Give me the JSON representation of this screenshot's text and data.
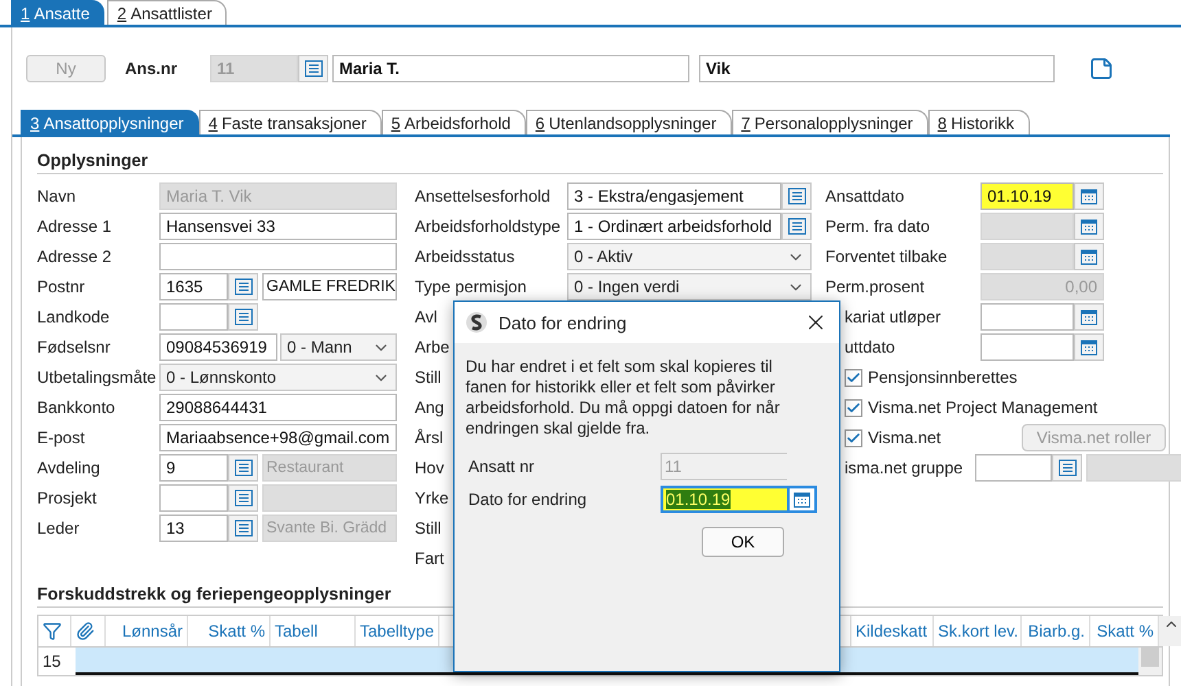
{
  "top_tabs": [
    {
      "key": "1",
      "label": "Ansatte",
      "selected": true
    },
    {
      "key": "2",
      "label": "Ansattlister",
      "selected": false
    }
  ],
  "header": {
    "new_button": {
      "label": "Ny",
      "disabled": true
    },
    "label": "Ans.nr",
    "number": "11",
    "first_name": "Maria T.",
    "last_name": "Vik"
  },
  "sub_tabs": [
    {
      "key": "3",
      "label": "Ansattopplysninger",
      "selected": true
    },
    {
      "key": "4",
      "label": "Faste transaksjoner",
      "selected": false
    },
    {
      "key": "5",
      "label": "Arbeidsforhold",
      "selected": false
    },
    {
      "key": "6",
      "label": "Utenlandsopplysninger",
      "selected": false
    },
    {
      "key": "7",
      "label": "Personalopplysninger",
      "selected": false
    },
    {
      "key": "8",
      "label": "Historikk",
      "selected": false
    }
  ],
  "section_title": "Opplysninger",
  "left_fields": [
    {
      "label": "Navn",
      "kind": "text",
      "value": "Maria T. Vik",
      "disabled": true
    },
    {
      "label": "Adresse 1",
      "kind": "text",
      "value": "Hansensvei 33",
      "disabled": false
    },
    {
      "label": "Adresse 2",
      "kind": "text",
      "disabled": false
    },
    {
      "label": "Postnr",
      "kind": "lookup",
      "value": "1635",
      "name": "GAMLE FREDRIK",
      "name_disabled": false
    },
    {
      "label": "Landkode",
      "kind": "lookup"
    },
    {
      "label": "Fødselsnr",
      "kind": "text_select",
      "value": "09084536919",
      "option": "0 - Mann"
    },
    {
      "label": "Utbetalingsmåte",
      "kind": "select",
      "value": "0 - Lønnskonto"
    },
    {
      "label": "Bankkonto",
      "kind": "text",
      "value": "29088644431",
      "disabled": false
    },
    {
      "label": "E-post",
      "kind": "text",
      "value": "Mariaabsence+98@gmail.com",
      "disabled": false
    },
    {
      "label": "Avdeling",
      "kind": "lookup",
      "value": "9",
      "name": "Restaurant",
      "name_disabled": true
    },
    {
      "label": "Prosjekt",
      "kind": "lookup",
      "name_disabled": true
    },
    {
      "label": "Leder",
      "kind": "lookup",
      "value": "13",
      "name": "Svante Bi. Grädd",
      "name_disabled": true
    }
  ],
  "middle_fields": [
    {
      "label": "Ansettelsesforhold",
      "kind": "lookup",
      "value": "3 - Ekstra/engasjement"
    },
    {
      "label": "Arbeidsforholdstype",
      "kind": "lookup",
      "value": "1 - Ordinært arbeidsforhold"
    },
    {
      "label": "Arbeidsstatus",
      "kind": "select",
      "value": "0 - Aktiv"
    },
    {
      "label": "Type permisjon",
      "kind": "select",
      "value": "0 - Ingen verdi"
    },
    {
      "label": "Avl",
      "kind": "label"
    },
    {
      "label": "Arbe",
      "kind": "label"
    },
    {
      "label": "Still",
      "kind": "label"
    },
    {
      "label": "Ang",
      "kind": "label"
    },
    {
      "label": "Årsl",
      "kind": "label"
    },
    {
      "label": "Hov",
      "kind": "label"
    },
    {
      "label": "Yrke",
      "kind": "label"
    },
    {
      "label": "Still",
      "kind": "label"
    },
    {
      "label": "Fart",
      "kind": "label"
    }
  ],
  "right_fields": [
    {
      "label": "Ansattdato",
      "kind": "date",
      "value": "01.10.19",
      "disabled": false,
      "highlighted": true
    },
    {
      "label": "Perm. fra dato",
      "kind": "date",
      "disabled": true,
      "highlighted": false
    },
    {
      "label": "Forventet tilbake",
      "kind": "date",
      "disabled": true,
      "highlighted": false
    },
    {
      "label": "Perm.prosent",
      "kind": "number",
      "value": "0,00"
    },
    {
      "label": "kariat utløper",
      "kind": "date",
      "disabled": false,
      "highlighted": false
    },
    {
      "label": "uttdato",
      "kind": "date",
      "disabled": false,
      "highlighted": false
    },
    {
      "label": "Pensjonsinnberettes",
      "kind": "checkbox",
      "checked": true
    },
    {
      "label": "Visma.net Project Management",
      "kind": "checkbox",
      "checked": true
    },
    {
      "label": "Visma.net",
      "kind": "checkbox",
      "checked": true,
      "button": {
        "label": "Visma.net roller",
        "disabled": true
      }
    },
    {
      "label": "isma.net gruppe",
      "kind": "lookup"
    }
  ],
  "table": {
    "title": "Forskuddstrekk og feriepengeopplysninger",
    "columns": [
      {
        "kind": "filter"
      },
      {
        "kind": "attachment"
      },
      {
        "kind": "text",
        "label": "Lønnsår"
      },
      {
        "kind": "text",
        "label": "Skatt %"
      },
      {
        "kind": "text",
        "label": "Tabell"
      },
      {
        "kind": "text",
        "label": "Tabelltype"
      },
      {
        "kind": "hidden"
      },
      {
        "kind": "text",
        "label": "Kildeskatt"
      },
      {
        "kind": "text",
        "label": "Sk.kort lev."
      },
      {
        "kind": "text",
        "label": "Biarb.g."
      },
      {
        "kind": "text",
        "label": "Skatt %"
      }
    ],
    "rows": [
      {
        "number": "15",
        "selected": true
      }
    ]
  },
  "dialog": {
    "title": "Dato for endring",
    "message": "Du har endret i et felt som skal kopieres til fanen for historikk eller et felt som påvirker arbeidsforhold. Du må oppgi datoen for når endringen skal gjelde fra.",
    "fields": [
      {
        "label": "Ansatt nr",
        "value": "11",
        "disabled": true,
        "highlighted": false
      },
      {
        "label": "Dato for endring",
        "value": "01.10.19",
        "disabled": false,
        "highlighted": true
      }
    ],
    "ok": "OK"
  }
}
